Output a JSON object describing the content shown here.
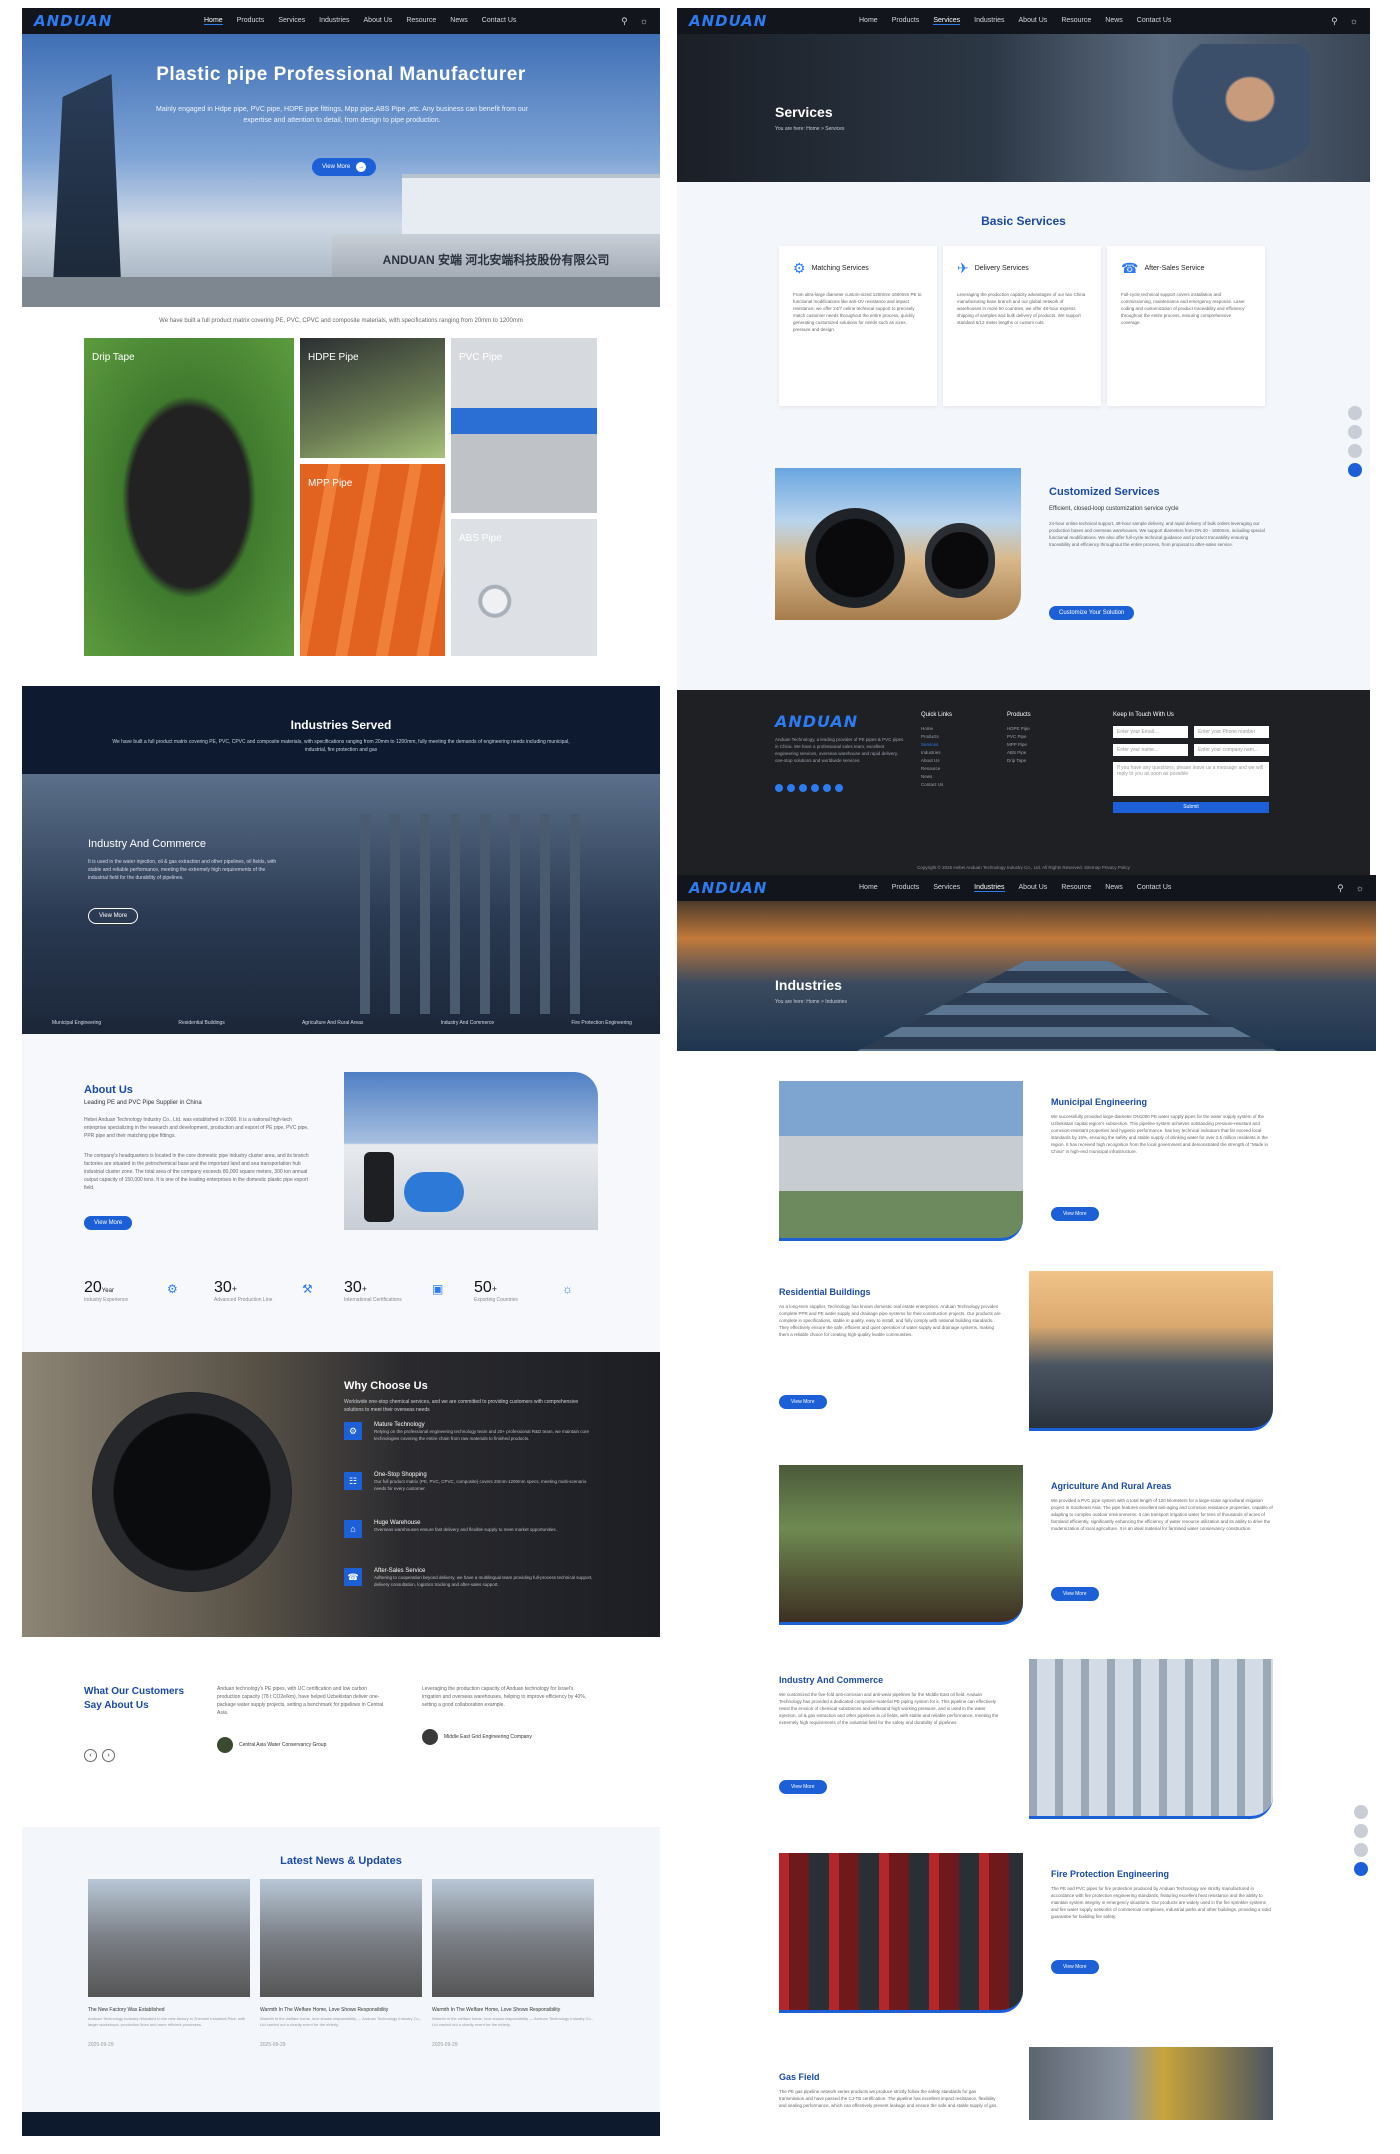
{
  "brand": "ANDUAN",
  "nav": {
    "items": [
      "Home",
      "Products",
      "Services",
      "Industries",
      "About Us",
      "Resource",
      "News",
      "Contact Us"
    ]
  },
  "home": {
    "hero_title": "Plastic pipe Professional Manufacturer",
    "hero_text": "Mainly engaged in Hdpe pipe, PVC pipe, HDPE pipe fittings, Mpp pipe,ABS Pipe ,etc. Any business can benefit from our expertise and attention to detail, from design to pipe production.",
    "hero_button": "View More",
    "sign_text": "ANDUAN 安端 河北安端科技股份有限公司",
    "products_caption": "We have built a full product matrix covering PE, PVC, CPVC and composite materials, with specifications ranging from 20mm to 1200mm",
    "products": [
      "Drip Tape",
      "HDPE Pipe",
      "PVC Pipe",
      "MPP Pipe",
      "ABS Pipe"
    ],
    "industries_title": "Industries Served",
    "industries_text": "We have built a full product matrix covering PE, PVC, CPVC and composite materials, with specifications ranging from 20mm to 1200mm, fully meeting the demands of engineering needs including municipal, industrial, fire protection and gas",
    "industries_feature_title": "Industry And Commerce",
    "industries_feature_text": "It is used in the water injection, oil & gas extraction and other pipelines, oil fields, with stable and reliable performance, meeting the extremely high requirements of the industrial field for the durability of pipelines.",
    "industries_button": "View More",
    "industries_tabs": [
      "Municipal Engineering",
      "Residential Buildings",
      "Agriculture And Rural Areas",
      "Industry And Commerce",
      "Fire Protection Engineering"
    ],
    "about_title": "About Us",
    "about_sub": "Leading PE and PVC Pipe Supplier in China",
    "about_text1": "Hebei Anduan Technology Industry Co., Ltd. was established in 2000. It is a national high-tech enterprise specializing in the research and development, production and export of PE pipe, PVC pipe, PPR pipe and their matching pipe fittings.",
    "about_text2": "The company's headquarters is located in the core domestic pipe industry cluster area, and its branch factories are situated in the petrochemical base and the important land and sea transportation hub industrial cluster zone. The total area of the company exceeds 80,000 square meters, 300 ton annual output capacity of 150,000 tons. It is one of the leading enterprises in the domestic plastic pipe export field.",
    "about_button": "View More",
    "stats": [
      {
        "value": "20",
        "unit": "Year",
        "label": "Industry Experience"
      },
      {
        "value": "30",
        "unit": "+",
        "label": "Advanced Production Line"
      },
      {
        "value": "30",
        "unit": "+",
        "label": "International Certifications"
      },
      {
        "value": "50",
        "unit": "+",
        "label": "Exporting Countries"
      }
    ],
    "why_title": "Why Choose Us",
    "why_text": "Worldwide one-stop chemical services, and we are committed to providing customers with comprehensive solutions to meet their overseas needs",
    "why_items": [
      {
        "title": "Mature Technology",
        "text": "Relying on the professional engineering technology team and 20+ professional R&D team, we maintain core technologies covering the entire chain from raw materials to finished products."
      },
      {
        "title": "One-Stop Shopping",
        "text": "Our full product matrix (PE, PVC, CPVC, composite) covers 20mm-1200mm specs, meeting multi-scenario needs for every customer."
      },
      {
        "title": "Huge Warehouse",
        "text": "Overseas warehouses ensure fast delivery and flexible supply to meet market opportunities."
      },
      {
        "title": "After-Sales Service",
        "text": "Adhering to cooperation beyond delivery, we have a multilingual team providing full-process technical support, delivery consultation, logistics tracking and after-sales support."
      }
    ],
    "testimonial_title": "What Our Customers Say About Us",
    "testimonials": [
      {
        "text": "Anduan technology's PE pipes, with UC certification and low carbon production capacity (78 t CO2e/km), have helped Uzbekistan deliver one-package water supply projects, setting a benchmark for pipelines in Central Asia.",
        "author": "Central Asia Water Conservancy Group"
      },
      {
        "text": "Leveraging the production capacity of Anduan technology for Israel's irrigation and overseas warehouses, helping to improve efficiency by 40%, setting a good collaboration example.",
        "author": "Middle East Grid Engineering Company"
      }
    ],
    "news_title": "Latest News & Updates",
    "news": [
      {
        "title": "The New Factory Was Established",
        "text": "Anduan Technology Industry relocated to the new factory in Zhenwei Industrial Park, with larger workshops, production lines and more efficient processes.",
        "date": "2025-09-29"
      },
      {
        "title": "Warmth In The Welfare Home, Love Shows Responsibility",
        "text": "Warmth in the welfare home, love shows responsibility — Anduan Technology Industry Co., Ltd carried out a charity event for the elderly.",
        "date": "2025-09-29"
      },
      {
        "title": "Warmth In The Welfare Home, Love Shows Responsibility",
        "text": "Warmth in the welfare home, love shows responsibility — Anduan Technology Industry Co., Ltd carried out a charity event for the elderly.",
        "date": "2025-09-29"
      }
    ]
  },
  "services": {
    "banner_title": "Services",
    "breadcrumb": "You are here:  Home  >  Services",
    "basic_title": "Basic Services",
    "basic": [
      {
        "title": "Matching Services",
        "text": "From ultra-large diameter custom-sized 1200mm-1600mm PE to functional modifications like anti-UV resistance and impact resistance, we offer 24/7 online technical support to precisely match customer needs throughout the entire process, quickly generating customized solutions for needs such as sizes, pressure and design."
      },
      {
        "title": "Delivery Services",
        "text": "Leveraging the production capacity advantages of our two China manufacturing base branch and our global network of warehouses in more 50 countries, we offer 48-hour express shipping of samples and bulk delivery of products. We support standard 6/12 meter lengths or custom cuts."
      },
      {
        "title": "After-Sales Service",
        "text": "Full-cycle technical support covers installation and commissioning, maintenance and emergency response. Laser coding and customization of product traceability and efficiency throughout the entire process, ensuring comprehensive coverage."
      }
    ],
    "custom_title": "Customized Services",
    "custom_sub": "Efficient, closed-loop customization service cycle",
    "custom_text": "24-hour online technical support, 48-hour sample delivery, and rapid delivery of bulk orders leveraging our production bases and overseas warehouses. We support diameters from DN 20 - 1600mm, including special functional modifications. We also offer full-cycle technical guidance and product traceability ensuring traceability and efficiency throughout the entire process, from proposal to after-sales service.",
    "custom_button": "Customize Your Solution"
  },
  "footer": {
    "about": "Anduan Technology, a leading provider of PE pipes & PVC pipes in China. We have a professional sales team, excellent engineering services, overseas warehouse and rapid delivery, one-stop solutions and worldwide services.",
    "quick_links_title": "Quick Links",
    "quick_links": [
      "Home",
      "Products",
      "Services",
      "Industries",
      "About Us",
      "Resource",
      "News",
      "Contact Us"
    ],
    "products_title": "Products",
    "products": [
      "HDPE Pipe",
      "PVC Pipe",
      "MPP Pipe",
      "ABS Pipe",
      "Drip Tape"
    ],
    "contact_title": "Keep In Touch With Us",
    "email_ph": "Enter your Email...",
    "phone_ph": "Enter your Phone number",
    "name_ph": "Enter your name...",
    "company_ph": "Enter your company nam...",
    "message_ph": "If you have any questions, please leave us a message and we will reply to you as soon as possible",
    "submit": "Submit",
    "copyright": "Copyright © 2025 Hebei Anduan Technology Industry Co., Ltd. All Rights Reserved.   Sitemap  Privacy Policy"
  },
  "industries": {
    "banner_title": "Industries",
    "breadcrumb": "You are here:  Home  >  Industries",
    "items": [
      {
        "title": "Municipal Engineering",
        "text": "We successfully provided large-diameter DN1000 PE water supply pipes for the water supply system of the Uzbekistan capital region's subsection. This pipeline system achieves outstanding pressure-resistant and corrosion-resistant properties and hygienic performance, has key technical indicators that far exceed local standards by 15%, ensuring the safety and stable supply of drinking water for over 2.5 million residents in the region. It has received high recognition from the local government and demonstrated the strength of \"Made in China\" in high-end municipal infrastructure."
      },
      {
        "title": "Residential Buildings",
        "text": "As a long-term supplier, Technology has known domestic real estate enterprises. Anduan Technology provides complete PPR and PE water supply and drainage pipe systems for their construction projects. Our products are complete in specifications, stable in quality, easy to install, and fully comply with national building standards. They effectively ensure the safe, efficient and quiet operation of water supply and drainage systems, making them a reliable choice for creating high-quality livable communities."
      },
      {
        "title": "Agriculture And Rural Areas",
        "text": "We provided a PVC pipe system with a total length of 120 kilometers for a large-scale agricultural irrigation project in Southeast Asia. The pipe features excellent anti-aging and corrosion resistance properties, capable of adapting to complex outdoor environments. It can transport irrigation water for tens of thousands of acres of farmland efficiently, significantly enhancing the efficiency of water resource utilization and its ability to drive the modernization of local agriculture. It is an ideal material for farmland water conservancy construction."
      },
      {
        "title": "Industry And Commerce",
        "text": "We customized the five-fold anti-corrosion and anti-wear pipelines for the Middle East oil field. Anduan Technology has provided a dedicated composite-material PE piping system for it. This pipeline can effectively resist the erosion of chemical substances and withstand high working pressure, and is used in the water injection, oil & gas extraction and other pipelines in oil fields, with stable and reliable performance, meeting the extremely high requirements of the industrial field for the safety and durability of pipelines."
      },
      {
        "title": "Fire Protection Engineering",
        "text": "The PE and PVC pipes for fire protection produced by Anduan Technology are strictly manufactured in accordance with fire protection engineering standards, featuring excellent heat resistance and the ability to maintain system integrity in emergency situations. Our products are widely used in the fire sprinkler systems and fire water supply networks of commercial complexes, industrial parks and other buildings, providing a solid guarantee for building fire safety."
      },
      {
        "title": "Gas Field",
        "text": "The PE gas pipeline network series products we produce strictly follow the safety standards for gas transmission and have passed the CJ-TB certification. The pipeline has excellent impact resistance, flexibility and sealing performance, which can effectively prevent leakage and ensure the safe and stable supply of gas."
      }
    ],
    "button": "View More"
  }
}
